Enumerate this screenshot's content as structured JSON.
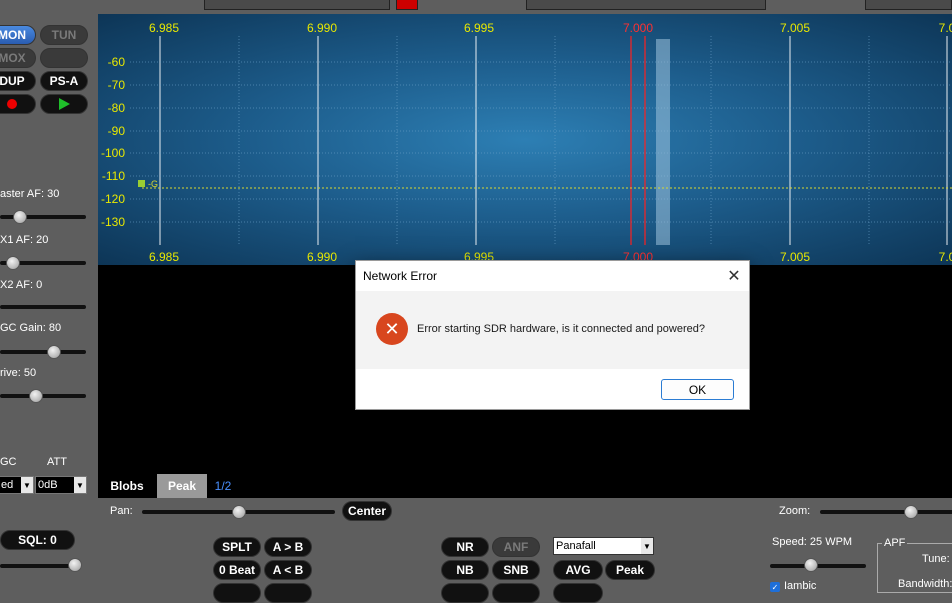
{
  "left": {
    "buttons": {
      "mon": "MON",
      "tun": "TUN",
      "mox": "MOX",
      "dup": "DUP",
      "psa": "PS-A"
    },
    "master_af": "aster AF:  30",
    "rx1_af": "X1 AF:  20",
    "rx2_af": "X2 AF:  0",
    "agc_gain": "GC Gain:  80",
    "drive": "rive:  50",
    "agc_label": "GC",
    "att_label": "ATT",
    "agc_value": "ed",
    "att_value": "0dB",
    "sql_label": "SQL:",
    "sql_value": "0",
    "levels": {
      "master_af": 30,
      "rx1_af": 20,
      "rx2_af": 0,
      "agc_gain": 80,
      "drive": 50
    }
  },
  "panadapter": {
    "freq_labels_top": [
      "6.985",
      "6.990",
      "6.995",
      "7.000",
      "7.005",
      "7.0"
    ],
    "freq_labels_bottom": [
      "6.985",
      "6.990",
      "6.995",
      "7.000",
      "7.005",
      "7.0"
    ],
    "db_labels": [
      "-60",
      "-70",
      "-80",
      "-90",
      "-100",
      "-110",
      "-120",
      "-130"
    ],
    "squelch_marker": "-G",
    "colors": {
      "tick_yellow": "#e8e800",
      "center_red": "#ff2020",
      "noise_line": "#d8d830"
    }
  },
  "blobs": {
    "blobs_label": "Blobs",
    "peak_label": "Peak",
    "page": "1/2"
  },
  "bottom": {
    "pan_label": "Pan:",
    "center_label": "Center",
    "zoom_label": "Zoom:",
    "buttons": [
      "SPLT",
      "A > B",
      "0 Beat",
      "A < B",
      "NR",
      "ANF",
      "NB",
      "SNB",
      "AVG",
      "Peak"
    ],
    "display_mode": "Panafall",
    "speed_label": "Speed:  25 WPM",
    "iambic_label": "Iambic",
    "apf_label": "APF",
    "tune_label": "Tune:",
    "bandwidth_label": "Bandwidth:"
  },
  "dialog": {
    "title": "Network Error",
    "message": "Error starting SDR hardware, is it connected and powered?",
    "ok_label": "OK",
    "close_glyph": "✕",
    "error_glyph": "✕"
  }
}
